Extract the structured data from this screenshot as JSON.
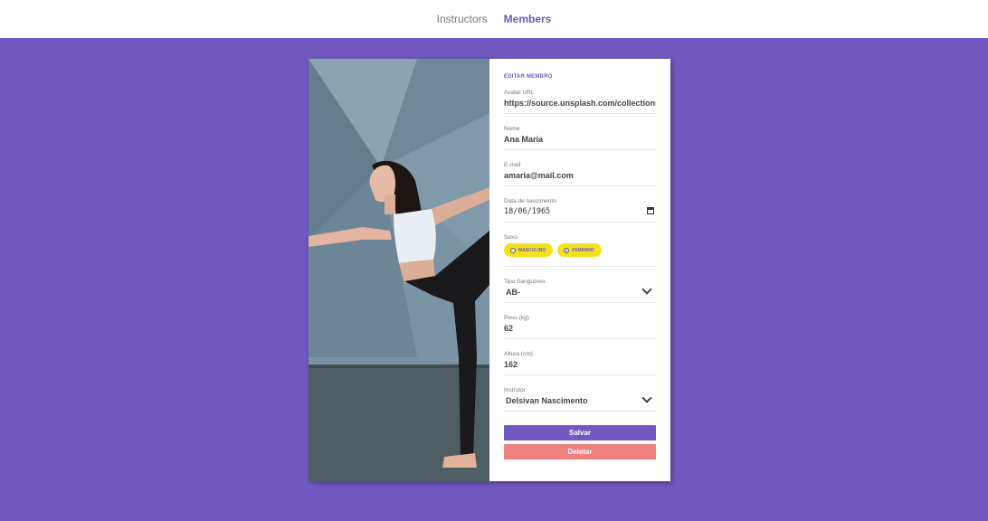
{
  "nav": {
    "items": [
      {
        "label": "Instructors",
        "active": false
      },
      {
        "label": "Members",
        "active": true
      }
    ]
  },
  "card": {
    "photo": "woman-yoga-pose-photo",
    "form": {
      "title": "EDITAR MEMBRO",
      "avatar_url": {
        "label": "Avatar URL",
        "value": "https://source.unsplash.com/collections/"
      },
      "name": {
        "label": "Nome",
        "value": "Ana Maria"
      },
      "email": {
        "label": "E-mail",
        "value": "amaria@mail.com"
      },
      "birth": {
        "label": "Data de nascimento",
        "value": "18/06/1965"
      },
      "sex": {
        "label": "Sexo",
        "options": [
          {
            "label": "MASCULINO",
            "checked": false
          },
          {
            "label": "FEMININO",
            "checked": true
          }
        ]
      },
      "blood": {
        "label": "Tipo Sanguíneo",
        "value": "AB-"
      },
      "weight": {
        "label": "Peso (kg)",
        "value": "62"
      },
      "height": {
        "label": "Altura (cm)",
        "value": "162"
      },
      "instructor": {
        "label": "Instrutor",
        "value": "Delsivan Nascimento"
      },
      "save_label": "Salvar",
      "delete_label": "Deletar"
    }
  },
  "colors": {
    "brand": "#7159c1",
    "pill": "#f5e21f",
    "delete": "#f08080"
  }
}
